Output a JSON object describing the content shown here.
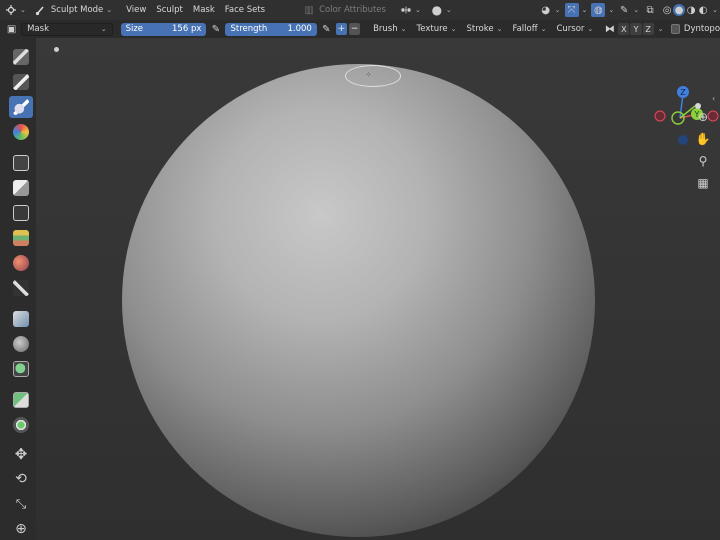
{
  "header": {
    "mode_label": "Sculpt Mode",
    "menus": [
      "View",
      "Sculpt",
      "Mask",
      "Face Sets"
    ],
    "color_attributes_label": "Color Attributes"
  },
  "tool_settings": {
    "brush_name": "Mask",
    "size_label": "Size",
    "size_value": "156 px",
    "strength_label": "Strength",
    "strength_value": "1.000",
    "plus_label": "+",
    "minus_label": "−",
    "menus": [
      "Brush",
      "Texture",
      "Stroke",
      "Falloff",
      "Cursor"
    ],
    "axes": [
      "X",
      "Y",
      "Z"
    ],
    "dyntopo_label": "Dyntopo"
  },
  "gizmo": {
    "z_label": "Z",
    "y_label": "Y",
    "colors": {
      "x": "#e04a5f",
      "y": "#8bd23c",
      "z": "#3f80e0"
    }
  },
  "toolbar": {
    "tools": [
      "draw-brush-icon",
      "draw-sharp-icon",
      "mask-brush-icon",
      "paint-brush-icon",
      "box-mask-icon",
      "box-hide-icon",
      "box-face-set-icon",
      "box-trim-icon",
      "line-project-icon",
      "mesh-filter-icon",
      "cloth-filter-icon",
      "color-filter-icon",
      "edit-face-set-icon",
      "mask-by-color-icon",
      "move-icon",
      "rotate-icon",
      "scale-icon",
      "transform-icon"
    ]
  }
}
